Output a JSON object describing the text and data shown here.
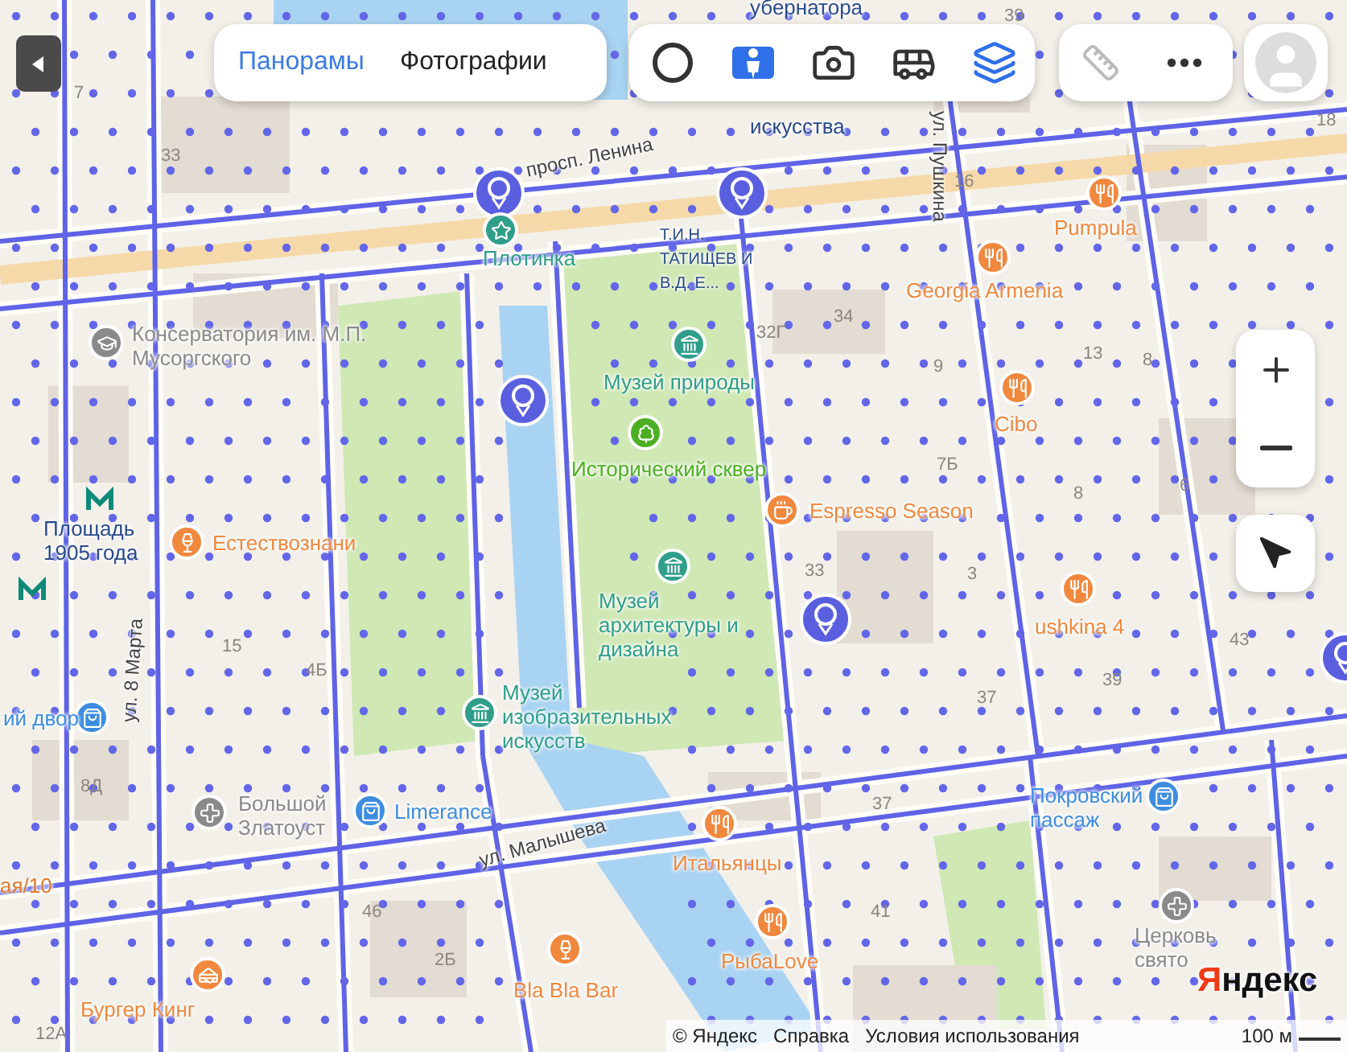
{
  "toolbar": {
    "tabs": [
      {
        "label": "Панорамы",
        "selected": true
      },
      {
        "label": "Фотографии",
        "selected": false
      }
    ]
  },
  "layers": [
    {
      "kind": "circle",
      "on": false
    },
    {
      "kind": "panorama",
      "on": true
    },
    {
      "kind": "camera",
      "on": false
    },
    {
      "kind": "bus",
      "on": false
    },
    {
      "kind": "layers",
      "on": true
    }
  ],
  "places": [
    {
      "kind": "restaurant",
      "name": "Pumpula",
      "color": "#f0883e"
    },
    {
      "kind": "restaurant",
      "name": "Georgia Armenia",
      "color": "#f0883e"
    },
    {
      "kind": "restaurant",
      "name": "Cibo",
      "color": "#f0883e"
    },
    {
      "kind": "cafe",
      "name": "Espresso Season",
      "color": "#f0883e"
    },
    {
      "kind": "restaurant",
      "name": "ushkina 4",
      "color": "#f0883e"
    },
    {
      "kind": "education",
      "name": "Консерватория им. М.П. Мусоргского",
      "color": "#8a8a8a"
    },
    {
      "kind": "bar",
      "name": "Естествознани",
      "color": "#f0883e"
    },
    {
      "kind": "museum",
      "name": "Музей природы",
      "color": "#2f9e8a"
    },
    {
      "kind": "park",
      "name": "Исторический сквер",
      "color": "#4caf23"
    },
    {
      "kind": "museum",
      "name": "Музей архитектуры и дизайна",
      "color": "#2f9e8a"
    },
    {
      "kind": "museum",
      "name": "Музей изобразительных искусств",
      "color": "#2f9e8a"
    },
    {
      "kind": "church",
      "name": "Большой Златоуст",
      "color": "#8a8a8a"
    },
    {
      "kind": "shop",
      "name": "Limerance",
      "color": "#3d8de0"
    },
    {
      "kind": "shop",
      "name": "Покровский пассаж",
      "color": "#3d8de0"
    },
    {
      "kind": "restaurant",
      "name": "Итальянцы",
      "color": "#f0883e"
    },
    {
      "kind": "restaurant",
      "name": "РыбаLove",
      "color": "#f0883e"
    },
    {
      "kind": "bar",
      "name": "Bla Bla Bar",
      "color": "#f0883e"
    },
    {
      "kind": "burger",
      "name": "Бургер Кинг",
      "color": "#f0883e"
    },
    {
      "kind": "church",
      "name": "Церковь свято",
      "color": "#8a8a8a"
    },
    {
      "kind": "shop",
      "name": "ий двор",
      "color": "#3d8de0"
    },
    {
      "kind": "landmark",
      "name": "Плотинка",
      "color": "#2f9e8a"
    },
    {
      "kind": "square",
      "name": "Площадь 1905 года",
      "color": "#2a4a8a"
    }
  ],
  "labels": [
    "убернатора",
    "искусства",
    "Т.И.Н. ТАТИЩЕВ И В.Д. Е...",
    "ая/10"
  ],
  "streets": [
    "просп. Ленина",
    "ул. 8 Марта",
    "ул. Малышева",
    "ул. Пушкина"
  ],
  "houses": [
    "33",
    "7",
    "39",
    "16",
    "18",
    "34",
    "32Г",
    "9",
    "13",
    "8",
    "7Б",
    "8",
    "6",
    "33",
    "3",
    "43",
    "39",
    "37",
    "15",
    "4Б",
    "8Д",
    "46",
    "2Б",
    "12А",
    "37",
    "41"
  ],
  "footer": {
    "copyright": "© Яндекс",
    "help": "Справка",
    "terms": "Условия использования",
    "scale": "100 м",
    "logo": "Яндекс"
  }
}
